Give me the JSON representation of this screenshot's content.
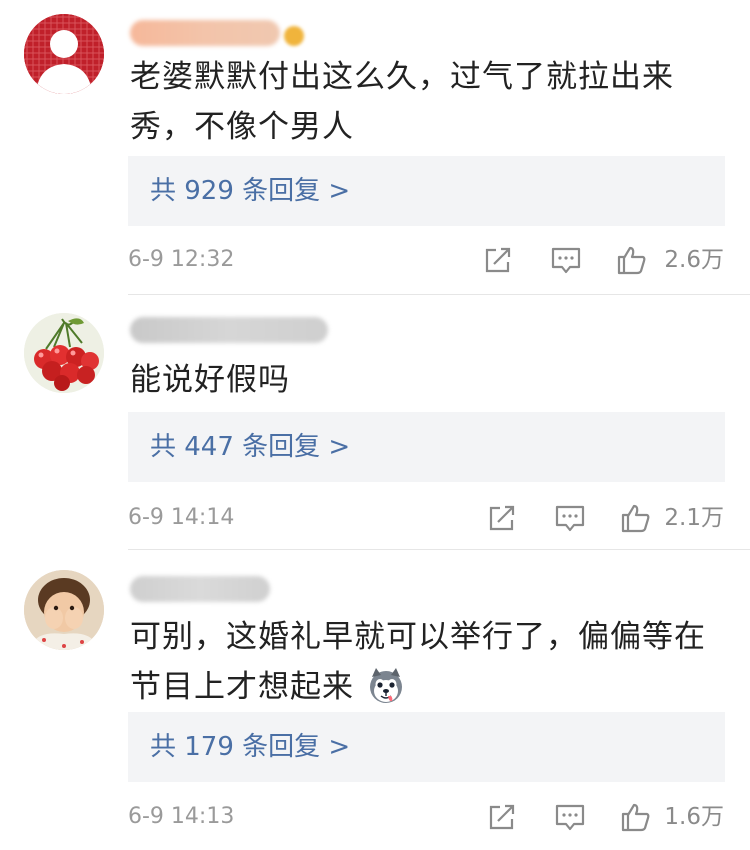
{
  "comments": [
    {
      "avatar_icon": "default-person-avatar",
      "text": "老婆默默付出这么久，过气了就拉出来秀，不像个男人",
      "replies_label": "共 929 条回复 >",
      "time": "6-9 12:32",
      "likes": "2.6万"
    },
    {
      "avatar_icon": "cherries-avatar",
      "text": "能说好假吗",
      "replies_label": "共 447 条回复 >",
      "time": "6-9 14:14",
      "likes": "2.1万"
    },
    {
      "avatar_icon": "child-photo-avatar",
      "text": "可别，这婚礼早就可以举行了，偏偏等在节目上才想起来",
      "emoji_icon": "husky-emoji",
      "replies_label": "共 179 条回复 >",
      "time": "6-9 14:13",
      "likes": "1.6万"
    }
  ],
  "icons": {
    "share": "share-icon",
    "comment": "comment-icon",
    "like": "thumbs-up-icon"
  },
  "colors": {
    "reply_link": "#4a6fa5",
    "reply_bg": "#f3f4f6",
    "meta_text": "#9a9a9a",
    "avatar_red": "#c0202a"
  }
}
